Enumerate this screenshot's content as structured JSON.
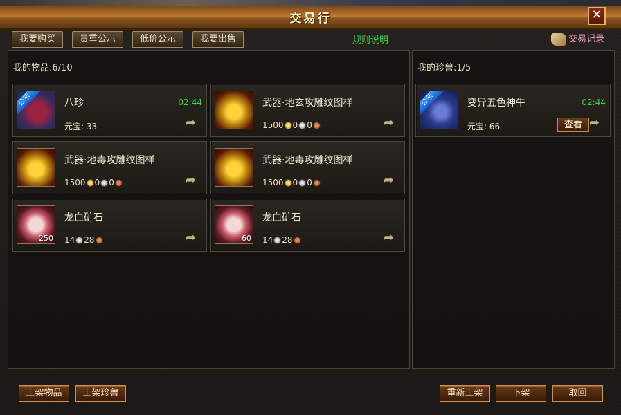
{
  "window": {
    "title": "交易行",
    "close_label": "✕"
  },
  "tabs": [
    "我要购买",
    "贵重公示",
    "低价公示",
    "我要出售"
  ],
  "rules_link": "规则说明",
  "trade_record": "交易记录",
  "items_panel": {
    "label": "我的物品",
    "count": "6/10",
    "items": [
      {
        "name": "八珍",
        "timer": "02:44",
        "price_label": "元宝:",
        "price": "33",
        "icon": "treasure-icon",
        "public_tag": "公示"
      },
      {
        "name": "武器·地玄攻雕纹图样",
        "gold": "1500",
        "silver": "0",
        "copper": "0",
        "icon": "scroll-icon"
      },
      {
        "name": "武器·地毒攻雕纹图样",
        "gold": "1500",
        "silver": "0",
        "copper": "0",
        "icon": "scroll-icon"
      },
      {
        "name": "武器·地毒攻雕纹图样",
        "gold": "1500",
        "silver": "0",
        "copper": "0",
        "icon": "scroll-icon"
      },
      {
        "name": "龙血矿石",
        "silver": "14",
        "copper": "28",
        "count": "250",
        "icon": "ore-icon"
      },
      {
        "name": "龙血矿石",
        "silver": "14",
        "copper": "28",
        "count": "60",
        "icon": "ore-icon"
      }
    ]
  },
  "beasts_panel": {
    "label": "我的珍兽",
    "count": "1/5",
    "beasts": [
      {
        "name": "变异五色神牛",
        "timer": "02:44",
        "price_label": "元宝:",
        "price": "66",
        "view_label": "查看",
        "icon": "beast-icon",
        "public_tag": "公示"
      }
    ]
  },
  "buttons": {
    "list_item": "上架物品",
    "list_beast": "上架珍兽",
    "relist": "重新上架",
    "delist": "下架",
    "retrieve": "取回"
  },
  "colors": {
    "timer": "#3fd24a",
    "rules_link": "#3fd24a",
    "trade_record": "#ff9ec8",
    "title_bar": "#c07a30"
  }
}
